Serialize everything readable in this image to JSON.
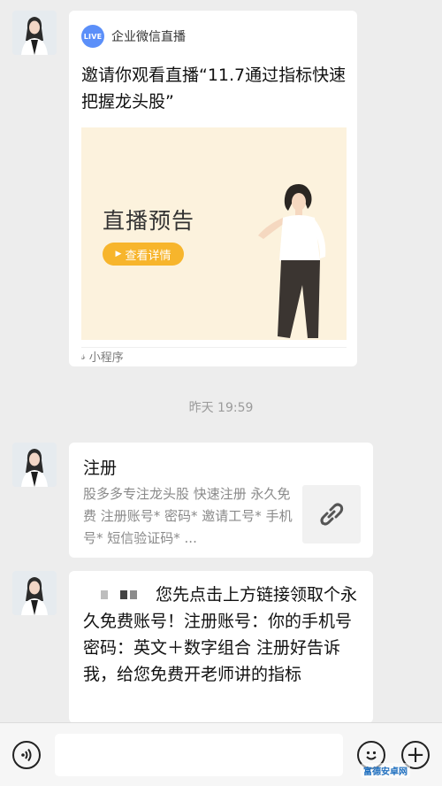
{
  "colors": {
    "background": "#ededed",
    "bubble": "#ffffff",
    "live_badge": "#5b8ff9",
    "preview_bg": "#fcf2dd",
    "preview_button": "#f7b52c",
    "muted_text": "#8a8a8a"
  },
  "messages": {
    "mini_program": {
      "badge": "LIVE",
      "source": "企业微信直播",
      "title": "邀请你观看直播“11.7通过指标快速把握龙头股”",
      "preview_heading": "直播预告",
      "preview_button": "查看详情",
      "footer_icon": "mini-program-icon",
      "footer_label": "小程序"
    },
    "timestamp": "昨天 19:59",
    "link_card": {
      "title": "注册",
      "description": "股多多专注龙头股 快速注册 永久免费 注册账号* 密码* 邀请工号* 手机号* 短信验证码* ...",
      "thumb_icon": "link-icon"
    },
    "text": {
      "body": "您先点击上方链接领取个永久免费账号！注册账号：你的手机号 密码：英文＋数字组合 注册好告诉我，给您免费开老师讲的指标"
    }
  },
  "input_bar": {
    "voice_icon": "voice-icon",
    "emoji_icon": "emoji-icon",
    "plus_icon": "plus-icon",
    "plus_glyph": "+"
  },
  "watermark": "富德安卓网"
}
